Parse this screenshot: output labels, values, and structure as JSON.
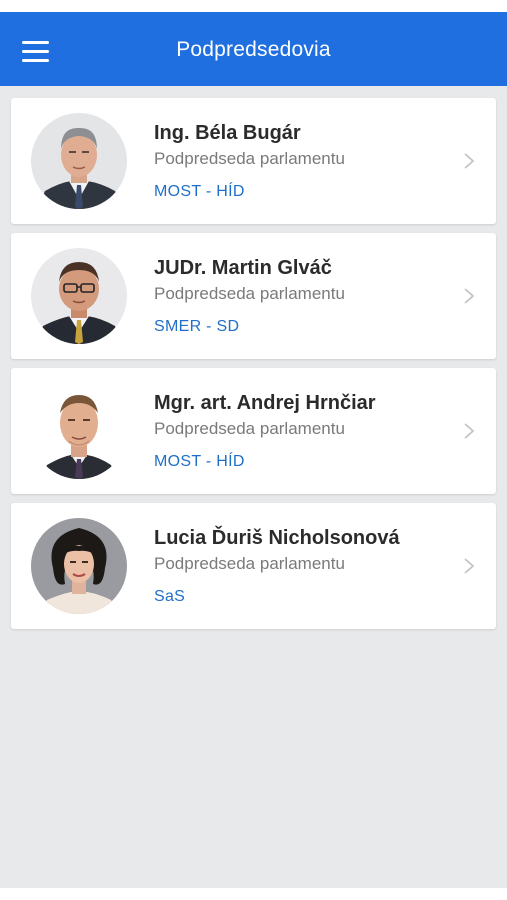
{
  "header": {
    "title": "Podpredsedovia",
    "menu_icon": "hamburger-menu-icon"
  },
  "colors": {
    "accent": "#1f6fe0",
    "party_link": "#1f6fc8",
    "background": "#e8e9eb"
  },
  "members": [
    {
      "name": "Ing. Béla Bugár",
      "role": "Podpredseda parlamentu",
      "party": "MOST - HÍD"
    },
    {
      "name": "JUDr. Martin Glváč",
      "role": "Podpredseda parlamentu",
      "party": "SMER - SD"
    },
    {
      "name": "Mgr. art. Andrej Hrnčiar",
      "role": "Podpredseda parlamentu",
      "party": "MOST - HÍD"
    },
    {
      "name": "Lucia Ďuriš Nicholsonová",
      "role": "Podpredseda parlamentu",
      "party": "SaS"
    }
  ]
}
